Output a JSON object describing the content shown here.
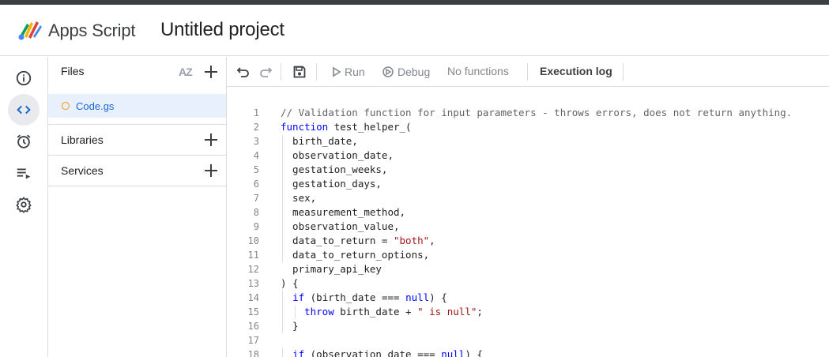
{
  "header": {
    "app_name": "Apps Script",
    "project_title": "Untitled project"
  },
  "rail": {
    "items": [
      {
        "icon": "info-icon",
        "label": "Overview"
      },
      {
        "icon": "code-icon",
        "label": "Editor",
        "active": true
      },
      {
        "icon": "alarm-clock-icon",
        "label": "Triggers"
      },
      {
        "icon": "executions-icon",
        "label": "Executions"
      },
      {
        "icon": "gear-icon",
        "label": "Project Settings"
      }
    ]
  },
  "files_panel": {
    "files_label": "Files",
    "sort_label": "AZ",
    "files": [
      {
        "name": "Code.gs"
      }
    ],
    "libraries_label": "Libraries",
    "services_label": "Services"
  },
  "toolbar": {
    "run_label": "Run",
    "debug_label": "Debug",
    "function_select": "No functions",
    "execution_log_label": "Execution log"
  },
  "editor": {
    "lines": [
      {
        "n": "1",
        "text": "// Validation function for input parameters - throws errors, does not return anything."
      },
      {
        "n": "2",
        "text": "function test_helper_("
      },
      {
        "n": "3",
        "text": "  birth_date,"
      },
      {
        "n": "4",
        "text": "  observation_date,"
      },
      {
        "n": "5",
        "text": "  gestation_weeks,"
      },
      {
        "n": "6",
        "text": "  gestation_days,"
      },
      {
        "n": "7",
        "text": "  sex,"
      },
      {
        "n": "8",
        "text": "  measurement_method,"
      },
      {
        "n": "9",
        "text": "  observation_value,"
      },
      {
        "n": "10",
        "text": "  data_to_return = \"both\","
      },
      {
        "n": "11",
        "text": "  data_to_return_options,"
      },
      {
        "n": "12",
        "text": "  primary_api_key"
      },
      {
        "n": "13",
        "text": ") {"
      },
      {
        "n": "14",
        "text": "  if (birth_date === null) {"
      },
      {
        "n": "15",
        "text": "    throw birth_date + \" is null\";"
      },
      {
        "n": "16",
        "text": "  }"
      },
      {
        "n": "17",
        "text": ""
      },
      {
        "n": "18",
        "text": "  if (observation_date === null) {"
      }
    ]
  },
  "colors": {
    "accent": "#1967d2",
    "selected_file_bg": "#e8f0fe",
    "keyword": "#0000ff",
    "string": "#a31515",
    "comment": "#5f6368",
    "file_dot": "#f29900"
  }
}
